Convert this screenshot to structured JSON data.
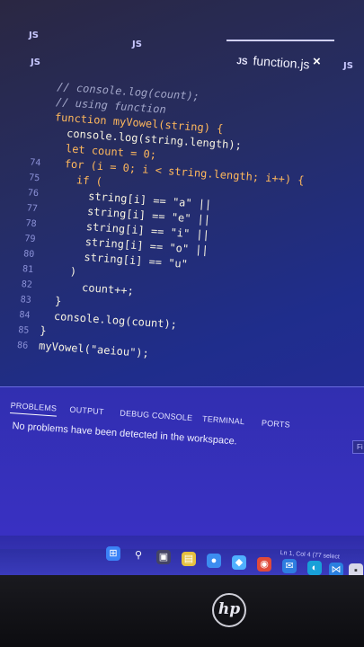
{
  "tabs": {
    "js1": "JS",
    "js2": "JS",
    "js3": "JS",
    "active_icon": "JS",
    "active_file": "function.js",
    "close": "×",
    "js4": "JS"
  },
  "code": {
    "lines": [
      {
        "num": "",
        "text": "// console.log(count);"
      },
      {
        "num": "",
        "text": "// using function"
      },
      {
        "num": "",
        "text": "function myVowel(string) {"
      },
      {
        "num": "",
        "text": "  console.log(string.length);"
      },
      {
        "num": "",
        "text": "  let count = 0;"
      },
      {
        "num": "74",
        "text": "  for (i = 0; i < string.length; i++) {"
      },
      {
        "num": "75",
        "text": "    if ("
      },
      {
        "num": "76",
        "text": "      string[i] == \"a\" ||"
      },
      {
        "num": "77",
        "text": "      string[i] == \"e\" ||"
      },
      {
        "num": "78",
        "text": "      string[i] == \"i\" ||"
      },
      {
        "num": "79",
        "text": "      string[i] == \"o\" ||"
      },
      {
        "num": "80",
        "text": "      string[i] == \"u\""
      },
      {
        "num": "81",
        "text": "    )"
      },
      {
        "num": "82",
        "text": "      count++;"
      },
      {
        "num": "83",
        "text": "  }"
      },
      {
        "num": "84",
        "text": "  console.log(count);"
      },
      {
        "num": "85",
        "text": "}"
      },
      {
        "num": "86",
        "text": "myVowel(\"aeiou\");"
      }
    ]
  },
  "panel": {
    "tabs": [
      "PROBLEMS",
      "OUTPUT",
      "DEBUG CONSOLE",
      "TERMINAL",
      "PORTS"
    ],
    "message": "No problems have been detected in the workspace.",
    "filter_stub": "Fi"
  },
  "status": {
    "position": "Ln 1, Col 4 (77 select"
  },
  "brand": {
    "logo": "hp"
  },
  "colors": {
    "keyword": "#ffb85c",
    "operator": "#ff66cc",
    "panel_bg": "#3a30c4"
  },
  "taskbar": {
    "icons": [
      "windows-icon",
      "search-icon",
      "file-explorer-icon",
      "widgets-icon",
      "chat-icon",
      "store-icon",
      "chrome-icon",
      "mail-icon",
      "edge-icon",
      "vscode-icon",
      "app-icon"
    ]
  }
}
